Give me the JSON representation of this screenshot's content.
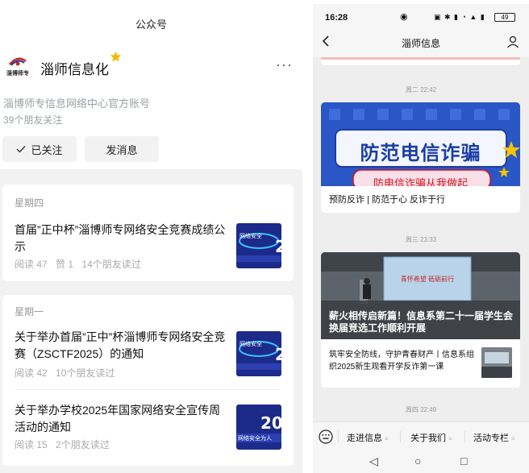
{
  "left": {
    "nav_title": "公众号",
    "account": {
      "name": "淄师信息化",
      "logo_text": "淄博师专",
      "description": "淄博师专信息网络中心官方账号",
      "followers": "39个朋友关注"
    },
    "buttons": {
      "followed": "已关注",
      "message": "发消息"
    },
    "groups": [
      {
        "day": "星期四",
        "articles": [
          {
            "title": "首届”正中杯”淄博师专网络安全竞赛成绩公示",
            "reads": "阅读 47",
            "likes": "赞 1",
            "friends": "14个朋友读过",
            "thumb_text": "网络安全"
          }
        ]
      },
      {
        "day": "星期一",
        "articles": [
          {
            "title": "关于举办首届”正中”杯淄博师专网络安全竞赛（ZSCTF2025）的通知",
            "reads": "阅读 42",
            "friends": "10个朋友读过",
            "thumb_text": "网络安全"
          },
          {
            "title": "关于举办学校2025年国家网络安全宣传周活动的通知",
            "reads": "阅读 15",
            "friends": "2个朋友读过",
            "thumb_text": "网络安全为人"
          }
        ]
      }
    ]
  },
  "phone": {
    "status": {
      "time": "16:28",
      "battery": "49"
    },
    "title": "淄师信息",
    "timestamps": [
      "周二 22:42",
      "周三 23:33",
      "周四 22:49"
    ],
    "card1": {
      "banner": "防范电信诈骗",
      "banner_sub": "防电信诈骗从我做起",
      "caption": "预防反诈 | 防范于心 反诈于行"
    },
    "card2": {
      "banner": "薪火相传启新篇！信息系第二十一届学生会换届竞选工作顺利开展",
      "screen_text": "青怀希望 砥砺前行",
      "sub": "筑牢安全防线，守护青春财产丨信息系组织2025新生观看开学反诈第一课"
    },
    "menu": [
      "走进信息",
      "关于我们",
      "活动专栏"
    ]
  },
  "colors": {
    "accent_blue": "#2a56c6",
    "star_yellow": "#f5b800",
    "banner_red": "#d4141c"
  }
}
